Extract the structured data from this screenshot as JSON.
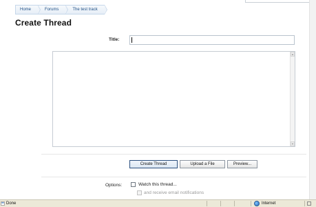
{
  "breadcrumb": [
    "Home",
    "Forums",
    "The test track"
  ],
  "page_title": "Create Thread",
  "form": {
    "title_label": "Title:",
    "title_value": "",
    "message_value": ""
  },
  "buttons": {
    "create": "Create Thread",
    "upload": "Upload a File",
    "preview": "Preview..."
  },
  "options": {
    "label": "Options:",
    "watch_thread": "Watch this thread...",
    "email_notifications": "and receive email notifications"
  },
  "status_bar": {
    "status": "Done",
    "zone": "Internet"
  },
  "colors": {
    "breadcrumb_text": "#1f4f86",
    "primary_button_border": "#2a4f7e"
  }
}
